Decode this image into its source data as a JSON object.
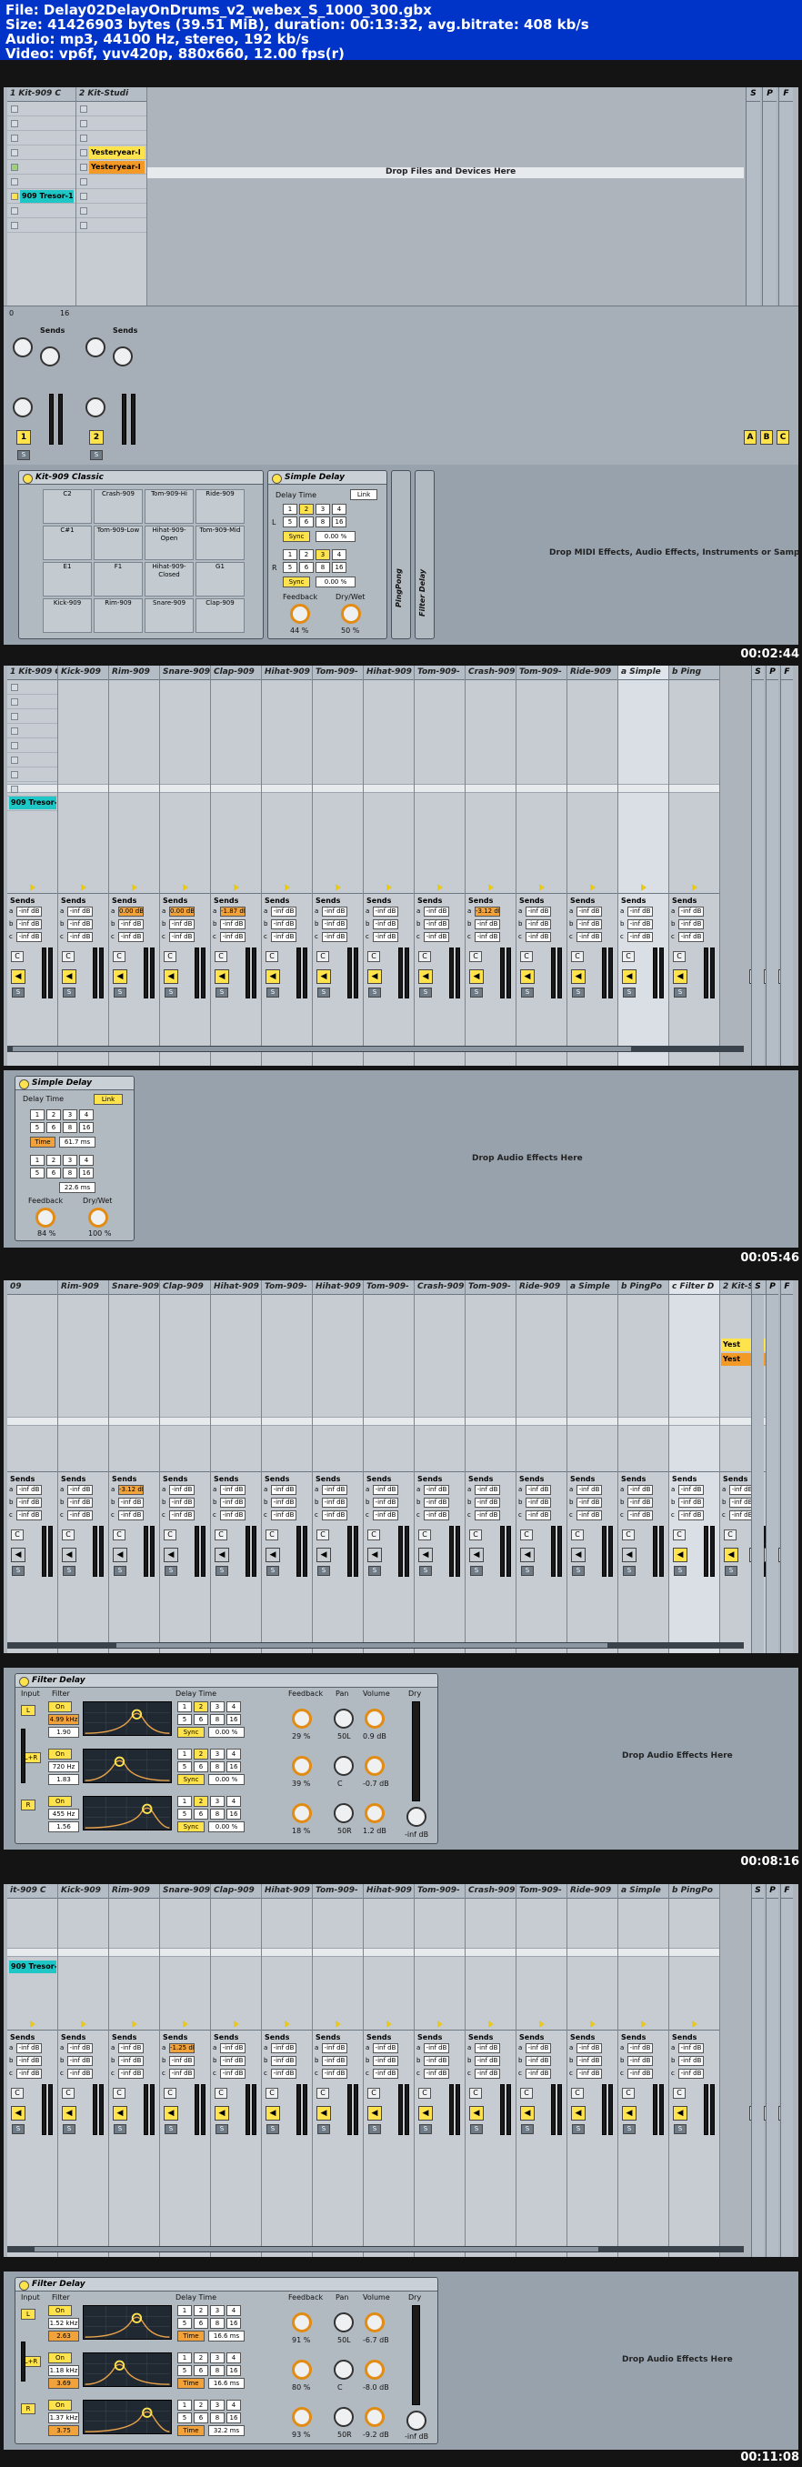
{
  "header": {
    "line1": "File: Delay02DelayOnDrums_v2_webex_S_1000_300.gbx",
    "line2": "Size: 41426903 bytes (39.51 MiB), duration: 00:13:32, avg.bitrate: 408 kb/s",
    "line3": "Audio: mp3, 44100 Hz, stereo, 192 kb/s",
    "line4": "Video: vp6f, yuv420p, 880x660, 12.00 fps(r)"
  },
  "frame1": {
    "timestamp": "00:02:44",
    "tracks": [
      {
        "name": "1 Kit-909 C"
      },
      {
        "name": "2 Kit-Studi"
      }
    ],
    "clips": {
      "a": "Yesteryear-I",
      "b": "Yesteryear-I",
      "c": "909 Tresor-1"
    },
    "drop_files": "Drop Files and Devices Here",
    "drop_midi": "Drop MIDI Effects, Audio Effects, Instruments or Samples Here",
    "returns": [
      "S",
      "P",
      "F"
    ],
    "return_buttons": [
      "A",
      "B",
      "C"
    ],
    "mixer": {
      "sends": "Sends",
      "track1": "1",
      "track2": "2",
      "s": "S",
      "counter": "16",
      "zero": "0"
    },
    "rack_title": "Kit-909 Classic",
    "pads": [
      "C2",
      "Crash-909",
      "Tom-909-Hi",
      "Ride-909",
      "C#1",
      "Tom-909-Low",
      "Hihat-909-Open",
      "Tom-909-Mid",
      "E1",
      "F1",
      "Hihat-909-Closed",
      "G1",
      "Kick-909",
      "Rim-909",
      "Snare-909",
      "Clap-909"
    ],
    "pad_mute": "M",
    "pad_solo": "S",
    "delay": {
      "title": "Simple Delay",
      "delay_time": "Delay Time",
      "link": "Link",
      "nums": [
        "1",
        "2",
        "3",
        "4",
        "5",
        "6",
        "8",
        "16"
      ],
      "sync": "Sync",
      "pct": "0.00 %",
      "L": "L",
      "R": "R",
      "feedback": "Feedback",
      "feedback_val": "44 %",
      "drywet": "Dry/Wet",
      "drywet_val": "50 %"
    },
    "vertical1": "PingPong",
    "vertical2": "Filter Delay"
  },
  "frame2": {
    "timestamp": "00:05:46",
    "tracks": [
      "1 Kit-909 C",
      "Kick-909",
      "Rim-909",
      "Snare-909",
      "Clap-909",
      "Hihat-909",
      "Tom-909-",
      "Hihat-909",
      "Tom-909-",
      "Crash-909",
      "Tom-909-",
      "Ride-909",
      "a Simple",
      "b Ping"
    ],
    "clip": "909 Tresor-1",
    "send_a": [
      "-inf dB",
      "-inf dB",
      "0.00 dB",
      "0.00 dB",
      "-1.87 dB",
      "-inf dB",
      "-inf dB",
      "-inf dB",
      "-inf dB",
      "-3.12 dB",
      "-inf dB",
      "-inf dB",
      "-inf dB"
    ],
    "send_b": "-inf dB",
    "sends": "Sends",
    "c": "C",
    "num": "1",
    "s": "S",
    "counter": "16",
    "two": "2",
    "drop": "Drop Audio Effects Here",
    "delay": {
      "title": "Simple Delay",
      "delay_time": "Delay Time",
      "link": "Link",
      "time": "Time",
      "time_val": "61.7 ms",
      "time_val2": "22.6 ms",
      "feedback": "Feedback",
      "feedback_val": "84 %",
      "drywet": "Dry/Wet",
      "drywet_val": "100 %"
    }
  },
  "frame3": {
    "timestamp": "00:08:16",
    "tracks": [
      "09",
      "Rim-909",
      "Snare-909",
      "Clap-909",
      "Hihat-909",
      "Tom-909-",
      "Hihat-909",
      "Tom-909-",
      "Crash-909",
      "Tom-909-",
      "Ride-909",
      "a Simple",
      "b PingPo",
      "c Filter D",
      "2 Kit-S"
    ],
    "clips": [
      "Yest",
      "Yest"
    ],
    "send_a": [
      "-inf dB",
      "-inf dB",
      "-3.12 dB",
      "-inf dB",
      "-inf dB",
      "-inf dB",
      "-inf dB",
      "-inf dB",
      "-inf dB",
      "-inf dB",
      "-inf dB",
      "-inf dB",
      "-inf dB"
    ],
    "send_b": "-inf dB",
    "drop": "Drop Audio Effects Here",
    "filter_delay": {
      "title": "Filter Delay",
      "input": "Input",
      "filter": "Filter",
      "on": "On",
      "freqs": [
        "4.99 kHz",
        "720 Hz",
        "455 Hz"
      ],
      "qs": [
        "1.90",
        "1.83",
        "1.56"
      ],
      "delay_time": "Delay Time",
      "sync": "Sync",
      "pct": "0.00 %",
      "feedback": "Feedback",
      "pan": "Pan",
      "volume": "Volume",
      "dry": "Dry",
      "fb_vals": [
        "29 %",
        "39 %",
        "18 %"
      ],
      "pan_vals": [
        "50L",
        "C",
        "50R"
      ],
      "vol_vals": [
        "0.9 dB",
        "-0.7 dB",
        "1.2 dB"
      ],
      "dry_val": "-inf dB",
      "L": "L",
      "LR": "L+R",
      "R": "R"
    }
  },
  "frame4": {
    "timestamp": "00:11:08",
    "tracks": [
      "it-909 C",
      "Kick-909",
      "Rim-909",
      "Snare-909",
      "Clap-909",
      "Hihat-909",
      "Tom-909-",
      "Hihat-909",
      "Tom-909-",
      "Crash-909",
      "Tom-909-",
      "Ride-909",
      "a Simple",
      "b PingPo"
    ],
    "clip": "909 Tresor-1",
    "send_a": [
      "-inf dB",
      "-inf dB",
      "-inf dB",
      "-1.25 dB",
      "-inf dB",
      "-inf dB",
      "-inf dB",
      "-inf dB",
      "-inf dB",
      "-inf dB",
      "-inf dB",
      "-inf dB",
      "-inf dB"
    ],
    "send_b": "-inf dB",
    "counter": "16",
    "nine": "9",
    "drop": "Drop Audio Effects Here",
    "filter_delay": {
      "title": "Filter Delay",
      "freqs": [
        "1.52 kHz",
        "1.18 kHz",
        "1.37 kHz"
      ],
      "qs": [
        "2.63",
        "3.69",
        "3.75"
      ],
      "time": "Time",
      "times": [
        "16.6 ms",
        "16.6 ms",
        "32.2 ms"
      ],
      "fb_vals": [
        "91 %",
        "80 %",
        "93 %"
      ],
      "pan_vals": [
        "50L",
        "C",
        "50R"
      ],
      "vol_vals": [
        "-6.7 dB",
        "-8.0 dB",
        "-9.2 dB"
      ],
      "dry_val": "-inf dB"
    }
  }
}
